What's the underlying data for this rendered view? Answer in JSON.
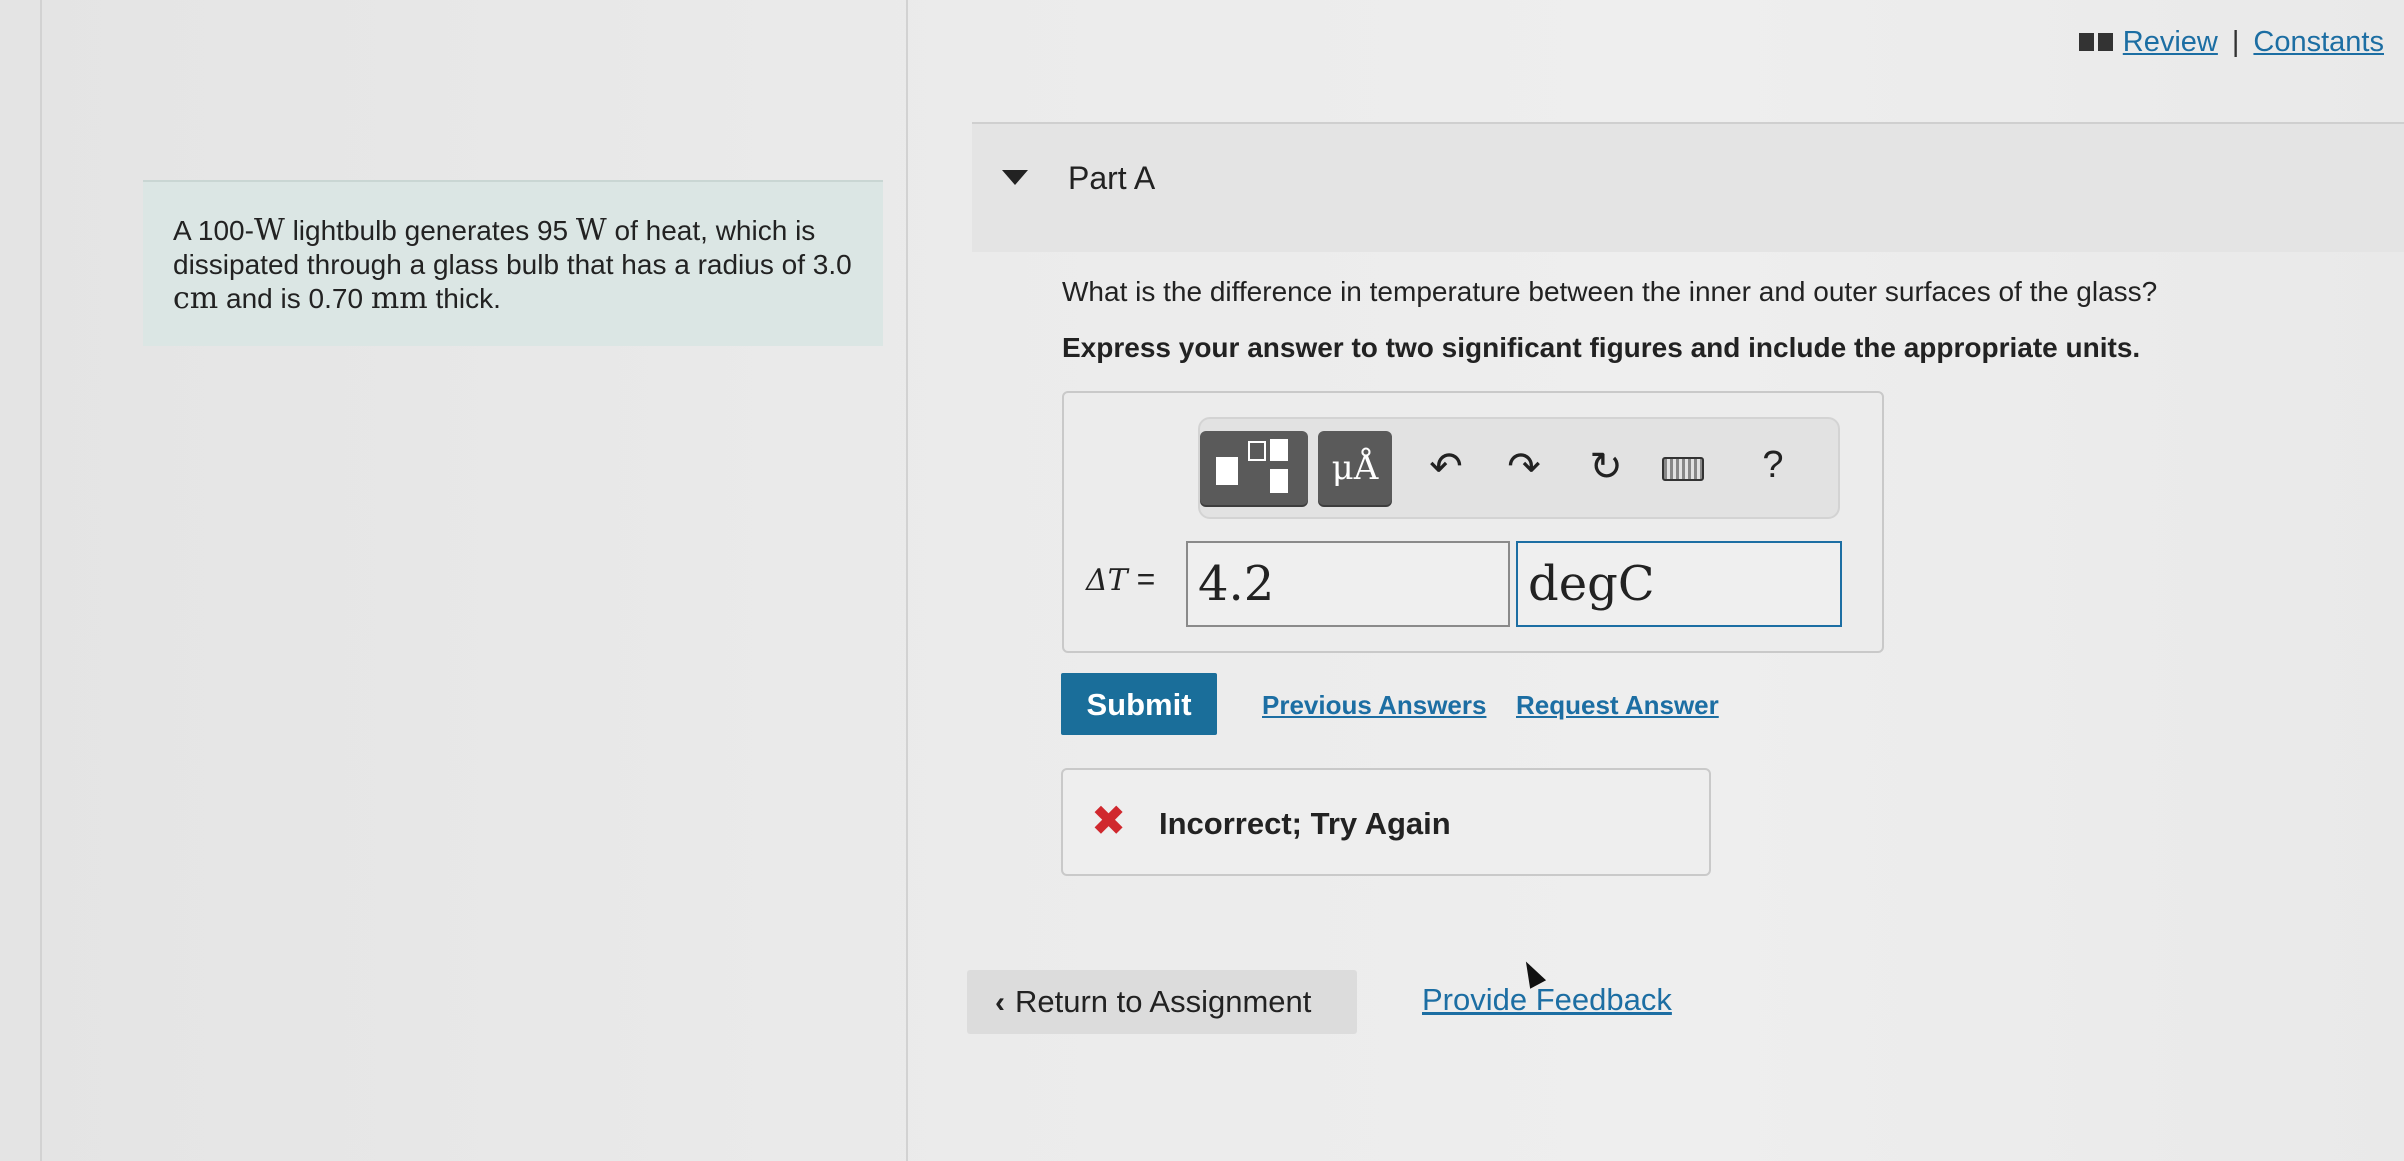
{
  "header": {
    "review_label": "Review",
    "separator": "|",
    "constants_label": "Constants",
    "icon": "book-icon"
  },
  "problem": {
    "t1": "A 100-",
    "m1": "W",
    "t2": " lightbulb generates 95 ",
    "m2": "W",
    "t3": " of heat, which is dissipated through a glass bulb that has a radius of 3.0 ",
    "m3": "cm",
    "t4": " and is 0.70 ",
    "m4": "mm",
    "t5": " thick."
  },
  "part": {
    "title": "Part A",
    "question": "What is the difference in temperature between the inner and outer surfaces of the glass?",
    "instruction": "Express your answer to two significant figures and include the appropriate units."
  },
  "toolbar": {
    "units_label": "μÅ",
    "undo_icon": "↶",
    "redo_icon": "↷",
    "reset_icon": "↻",
    "help_label": "?"
  },
  "answer": {
    "var_symbol": "ΔT",
    "equals": " =",
    "value": "4.2",
    "units": "degC"
  },
  "actions": {
    "submit_label": "Submit",
    "previous_answers": "Previous Answers",
    "request_answer": "Request Answer"
  },
  "feedback": {
    "icon_glyph": "✖",
    "message": "Incorrect; Try Again",
    "color": "#d0282e"
  },
  "footer": {
    "return_label": "Return to Assignment",
    "return_chevron": "‹",
    "provide_feedback": "Provide Feedback"
  }
}
